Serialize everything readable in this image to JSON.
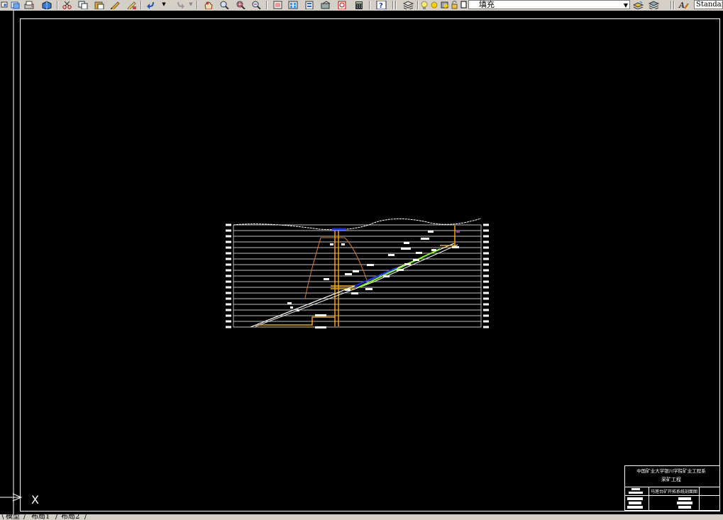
{
  "toolbar": {
    "layer_value": "填充",
    "text_style_value": "Standard",
    "icons": [
      "zoom-previous-icon",
      "publish-icon",
      "plot-icon",
      "3d-dwf-icon",
      "cut-icon",
      "copy-icon",
      "paste-icon",
      "match-properties-icon",
      "block-editor-icon",
      "undo-icon",
      "undo-dropdown-icon",
      "redo-icon",
      "redo-dropdown-icon",
      "pan-icon",
      "zoom-realtime-icon",
      "zoom-window-icon",
      "zoom-previous-icon",
      "properties-icon",
      "design-center-icon",
      "tool-palettes-icon",
      "sheet-set-icon",
      "markup-icon",
      "quickcalc-icon",
      "help-icon",
      "layer-properties-icon",
      "layer-state-icons",
      "make-object-layer-current-icon",
      "layer-previous-icon",
      "text-style-icon"
    ]
  },
  "titleblock": {
    "line1": "中国矿业大学银川学院矿业工程系",
    "line2": "采矿工程",
    "drawing_name": "马莲台矿开拓系统剖面图"
  },
  "ucs": {
    "axis_label": "X"
  },
  "tabs": [
    "模型",
    "布局1",
    "布局2"
  ],
  "colors": {
    "canvas": "#000000",
    "toolbar": "#d4d0c8",
    "shaft": "#f5a300",
    "terrain": "#ffffff",
    "roadway": "#1a2bff",
    "boundary": "#d07a2c",
    "seam": "#7fff00"
  }
}
